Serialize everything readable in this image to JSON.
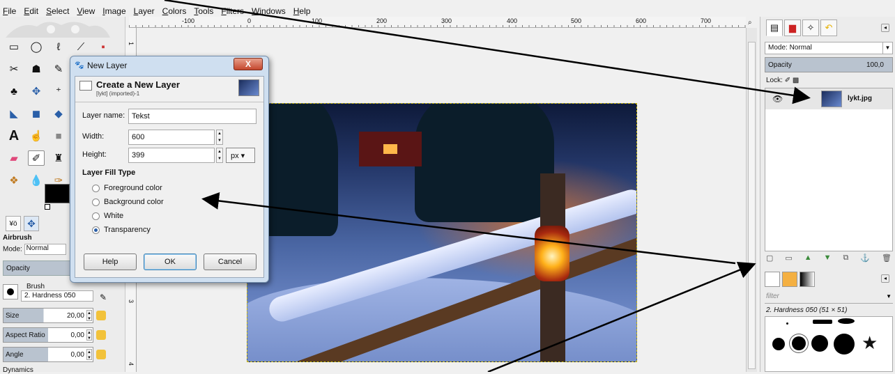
{
  "menu": [
    "File",
    "Edit",
    "Select",
    "View",
    "Image",
    "Layer",
    "Colors",
    "Tools",
    "Filters",
    "Windows",
    "Help"
  ],
  "ruler": {
    "h": [
      "-100",
      "0",
      "100",
      "200",
      "300",
      "400",
      "500",
      "600",
      "700"
    ],
    "v": [
      "1",
      "2",
      "3",
      "4"
    ]
  },
  "toolbox": {
    "tool_name": "Airbrush",
    "mode_label": "Mode:",
    "mode_value": "Normal",
    "opacity_label": "Opacity",
    "brush_label": "Brush",
    "brush_name": "2. Hardness 050",
    "size_label": "Size",
    "size_value": "20,00",
    "aspect_label": "Aspect Ratio",
    "aspect_value": "0,00",
    "angle_label": "Angle",
    "angle_value": "0,00",
    "dynamics_label": "Dynamics"
  },
  "layers": {
    "mode_label": "Mode:",
    "mode_value": "Normal",
    "opacity_label": "Opacity",
    "opacity_value": "100,0",
    "lock_label": "Lock:",
    "layer_name": "lykt.jpg"
  },
  "brushes": {
    "filter_placeholder": "filter",
    "info": "2. Hardness 050 (51 × 51)"
  },
  "dialog": {
    "window_title": "New Layer",
    "close_label": "X",
    "heading": "Create a New Layer",
    "subheading": "[lykt] (imported)-1",
    "name_label": "Layer name:",
    "name_value": "Tekst",
    "width_label": "Width:",
    "width_value": "600",
    "height_label": "Height:",
    "height_value": "399",
    "unit": "px",
    "fill_title": "Layer Fill Type",
    "fill_options": [
      "Foreground color",
      "Background color",
      "White",
      "Transparency"
    ],
    "help_label": "Help",
    "ok_label": "OK",
    "cancel_label": "Cancel"
  }
}
